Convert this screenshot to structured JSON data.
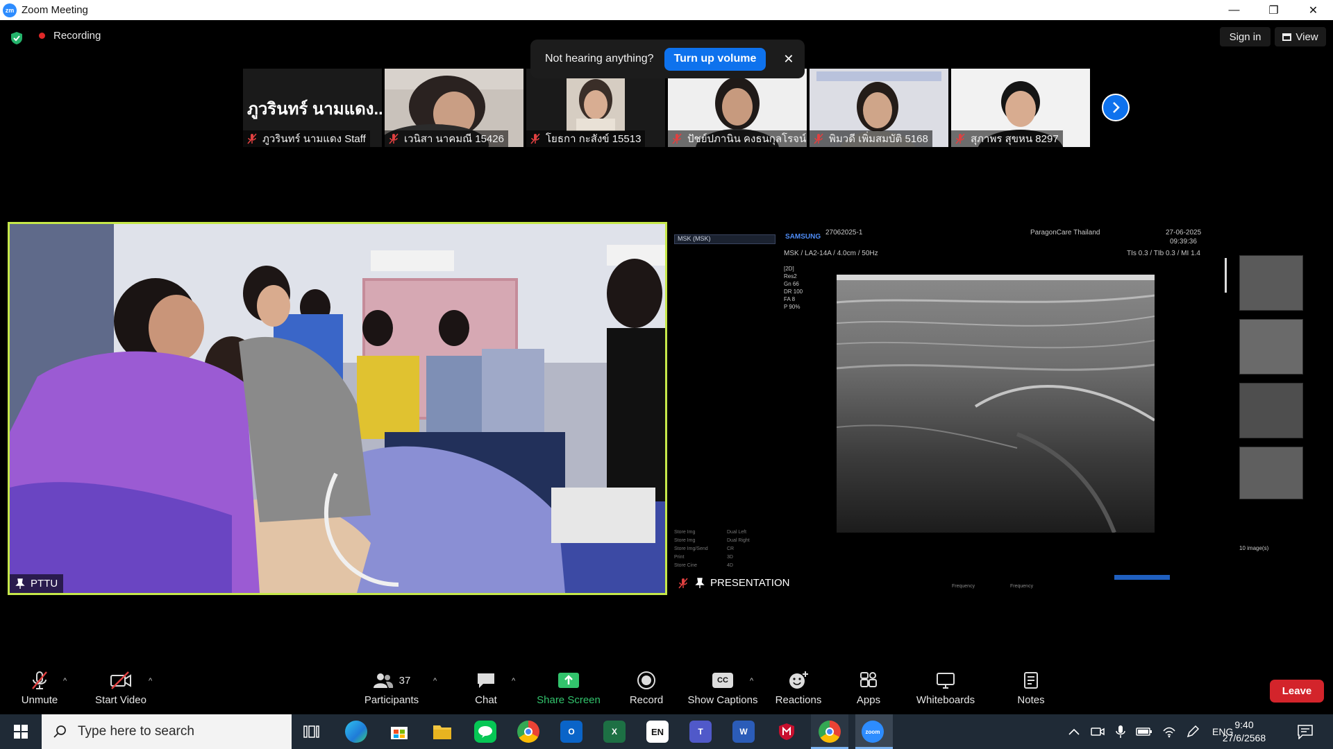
{
  "window": {
    "title": "Zoom Meeting",
    "minimize": "—",
    "restore": "❐",
    "close": "✕",
    "logo_text": "zm"
  },
  "header": {
    "recording_label": "Recording",
    "sign_in_label": "Sign in",
    "view_label": "View"
  },
  "toast": {
    "message": "Not hearing anything?",
    "button_label": "Turn up volume",
    "close": "✕"
  },
  "thumbnails": [
    {
      "name": "ภูวรินทร์ นามแดง Staff",
      "display_text": "ภูวรินทร์ นามแดง..."
    },
    {
      "name": "เวนิสา นาคมณี 15426"
    },
    {
      "name": "โยธกา กะสังข์ 15513"
    },
    {
      "name": "ปัชย์ปภานิน คงธนกุลโรจน์..."
    },
    {
      "name": "พิมวดี เพิ่มสมบัติ 5168"
    },
    {
      "name": "สุภาพร สุขหน 8297"
    }
  ],
  "main_tiles": {
    "left_label": "PTTU",
    "right_label": "PRESENTATION"
  },
  "ultrasound": {
    "preset": "MSK (MSK)",
    "brand": "SAMSUNG",
    "patient_id": "27062025-1",
    "facility": "ParagonCare Thailand",
    "date": "27-06-2025",
    "time": "09:39:36",
    "probe_line": "MSK / LA2-14A / 4.0cm / 50Hz",
    "thermal": "TIs 0.3 / TIb 0.3 / MI 1.4",
    "params": [
      "[2D]",
      "Res2",
      "Gn 66",
      "DR 100",
      "FA 8",
      "P 90%"
    ],
    "menu_left": [
      "Store Img",
      "Store Img",
      "Store Img/Send",
      "Print",
      "Store Cine"
    ],
    "menu_right": [
      "Dual Left",
      "Dual Right",
      "CR",
      "3D",
      "4D"
    ],
    "images_count": "10 image(s)",
    "freq_left": "Frequency",
    "freq_right": "Frequency"
  },
  "toolbar": {
    "unmute": "Unmute",
    "start_video": "Start Video",
    "participants": "Participants",
    "participants_count": "37",
    "chat": "Chat",
    "share_screen": "Share Screen",
    "record": "Record",
    "show_captions": "Show Captions",
    "captions_icon": "CC",
    "reactions": "Reactions",
    "apps": "Apps",
    "whiteboards": "Whiteboards",
    "notes": "Notes",
    "leave": "Leave",
    "caret": "^"
  },
  "taskbar": {
    "search_placeholder": "Type here to search",
    "language": "ENG",
    "time": "9:40",
    "date": "27/6/2568",
    "en_badge": "EN",
    "excel_letter": "X",
    "word_letter": "W",
    "outlook_letter": "O",
    "teams_letter": "T",
    "zoom_text": "zoom"
  },
  "colors": {
    "accent": "#0e72ed",
    "leave": "#d3242b",
    "share": "#32c36c",
    "active_speaker": "#c6e84a"
  }
}
